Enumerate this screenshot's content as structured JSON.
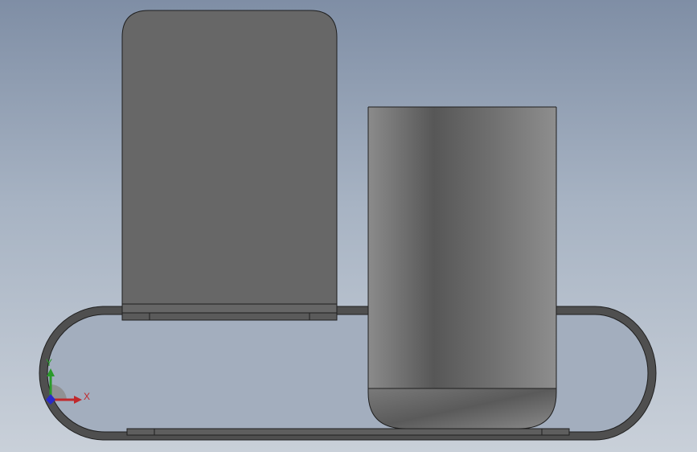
{
  "scene": {
    "background_top": "#7f8ea5",
    "background_bottom": "#c9d0d9",
    "part_color": "#666666",
    "edge_color": "#1f1f1f"
  },
  "triad": {
    "x_label": "X",
    "y_label": "Y",
    "x_color": "#c0282c",
    "y_color": "#2a9a2a",
    "z_color": "#2a2ac8"
  }
}
